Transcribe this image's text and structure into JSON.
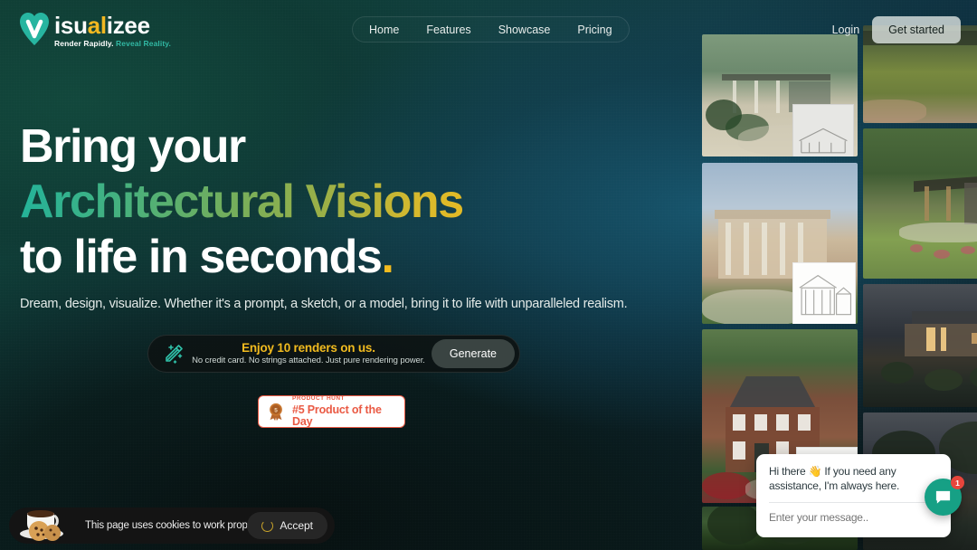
{
  "brand": {
    "name_part1": "isu",
    "name_accent1": "a",
    "name_accent2": "l",
    "name_part2": "izee",
    "full_name": "Visualizee",
    "tagline_white": "Render Rapidly.",
    "tagline_teal": "Reveal Reality.",
    "logo_icon": "v-heart-icon",
    "accent_gold": "#f2b821",
    "accent_teal": "#31b8a3"
  },
  "nav": {
    "items": [
      {
        "label": "Home"
      },
      {
        "label": "Features"
      },
      {
        "label": "Showcase"
      },
      {
        "label": "Pricing"
      }
    ]
  },
  "auth": {
    "login_label": "Login",
    "get_started_label": "Get started"
  },
  "hero": {
    "line1": "Bring your",
    "line2": "Architectural Visions",
    "line3": "to life in seconds",
    "period": ".",
    "subtitle": "Dream, design, visualize. Whether it's a prompt, a sketch, or a model, bring it to life with unparalleled realism.",
    "gradient_start": "#23b39a",
    "gradient_end": "#f5c31c"
  },
  "cta_banner": {
    "icon": "magic-wand-icon",
    "title": "Enjoy 10 renders on us.",
    "note": "No credit card. No strings attached. Just pure rendering power.",
    "button_label": "Generate"
  },
  "product_hunt": {
    "icon": "medal-icon",
    "medal_number": "5",
    "label": "PRODUCT HUNT",
    "rank": "#5 Product of the Day",
    "accent": "#ea5a44"
  },
  "chat": {
    "greeting": "Hi there 👋 If you need any assistance, I'm always here.",
    "input_placeholder": "Enter your message..",
    "input_value": "",
    "fab_icon": "chat-bubble-icon",
    "unread_count": "1",
    "fab_color": "#16a085",
    "badge_color": "#e8453c"
  },
  "cookie_banner": {
    "icon": "cookies-coffee-icon",
    "message": "This page uses cookies to work properly.",
    "accept_label": "Accept",
    "spinner_icon": "loading-spinner-icon"
  },
  "gallery": {
    "items": [
      {
        "name": "pavilion-in-jungle",
        "scene": "scene-pavilion",
        "sketch": "pavilion-sketch"
      },
      {
        "name": "lawn-courtyard",
        "scene": "scene-lawn",
        "sketch": "courtyard-sketch"
      },
      {
        "name": "classical-mansion",
        "scene": "scene-classical",
        "sketch": "mansion-sketch"
      },
      {
        "name": "modern-glass-house",
        "scene": "scene-modern",
        "sketch": "modern-sketch"
      },
      {
        "name": "brick-colonial-house",
        "scene": "scene-brick",
        "sketch": "colonial-sketch"
      },
      {
        "name": "night-hillside-villa",
        "scene": "scene-night",
        "sketch": "villa-sketch"
      },
      {
        "name": "forest-canopy",
        "scene": "scene-forest",
        "sketch": ""
      }
    ]
  }
}
